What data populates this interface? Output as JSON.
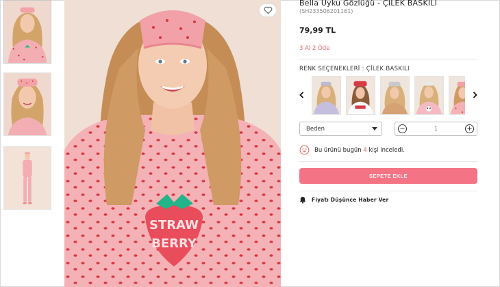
{
  "product": {
    "title": "Bella Uyku Gözlüğü - ÇİLEK BASKILI",
    "code": "(SH233506201161)",
    "price": "79,99 TL",
    "promo": "3 Al 2 Öde"
  },
  "colors": {
    "label": "RENK SEÇENEKLERİ : ÇİLEK BASKILI",
    "swatches": [
      "swatch-lilac",
      "swatch-white-red",
      "swatch-grey",
      "swatch-pink-panda",
      "swatch-pink-strawberry"
    ]
  },
  "size": {
    "label": "Beden"
  },
  "quantity": {
    "minus": "−",
    "value": "1",
    "plus": "+"
  },
  "viewers": {
    "prefix": "Bu ürünü bugün",
    "count": "4",
    "suffix": "kişi inceledi."
  },
  "actions": {
    "add_to_cart": "SEPETE EKLE",
    "price_alert": "Fiyatı Düşünce Haber Ver"
  },
  "theme": {
    "accent": "#f47384",
    "promo_color": "#e06b6b",
    "main_bg": "#f0dfd4"
  },
  "icons": [
    "heart-icon",
    "chevron-left-icon",
    "chevron-right-icon",
    "smile-icon",
    "bell-icon",
    "minus-icon",
    "plus-icon",
    "caret-down-icon"
  ]
}
